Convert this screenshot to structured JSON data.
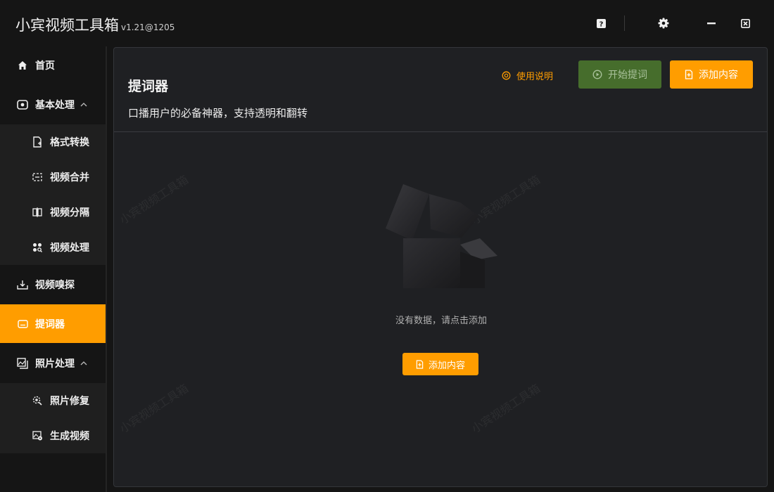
{
  "app": {
    "title": "小宾视频工具箱",
    "version": "v1.21@1205"
  },
  "titlebar": {
    "help_icon": "help-icon",
    "settings_icon": "gear-icon",
    "minimize_icon": "minimize-icon",
    "close_icon": "close-icon"
  },
  "sidebar": {
    "home": "首页",
    "basic": "基本处理",
    "format_convert": "格式转换",
    "video_merge": "视频合并",
    "video_split": "视频分隔",
    "video_process": "视频处理",
    "video_sniff": "视频嗅探",
    "teleprompter": "提词器",
    "photo": "照片处理",
    "photo_repair": "照片修复",
    "generate_video": "生成视频"
  },
  "panel": {
    "title": "提词器",
    "subtitle": "口播用户的必备神器，支持透明和翻转",
    "help_label": "使用说明",
    "start_label": "开始提词",
    "add_label": "添加内容",
    "empty_text": "没有数据，请点击添加",
    "add_center_label": "添加内容",
    "watermark": "小宾视频工具箱"
  },
  "colors": {
    "accent": "#ff9d00",
    "start_button": "#466d2c",
    "panel_bg": "#1f2023",
    "sidebar_bg": "#151515"
  }
}
